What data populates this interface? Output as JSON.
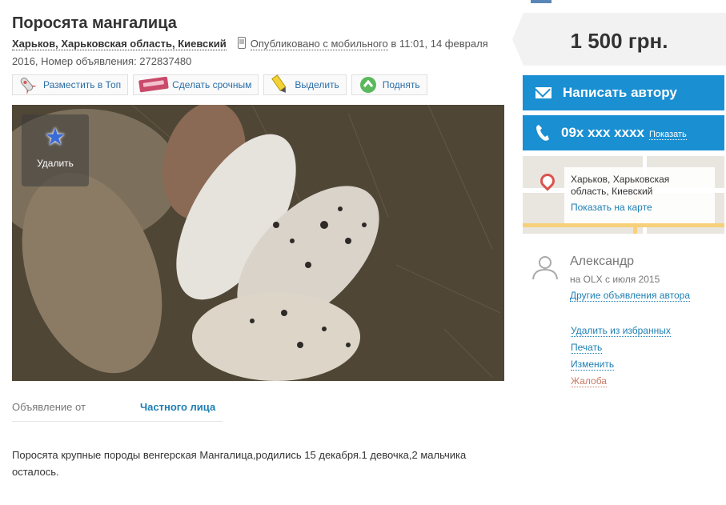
{
  "listing": {
    "title": "Поросята мангалица",
    "location": "Харьков, Харьковская область, Киевский",
    "published_text": "Опубликовано с мобильного",
    "published_time": " в 11:01, 14 февраля 2016, Номер объявления: 272837480"
  },
  "actions": [
    {
      "label": "Разместить в Топ",
      "icon": "rocket-icon"
    },
    {
      "label": "Сделать срочным",
      "icon": "urgent-sticker-icon"
    },
    {
      "label": "Выделить",
      "icon": "highlighter-icon"
    },
    {
      "label": "Поднять",
      "icon": "refresh-up-icon"
    }
  ],
  "photo": {
    "favorite_label": "Удалить"
  },
  "details": {
    "from_key": "Объявление от",
    "from_value": "Частного лица"
  },
  "description": "Поросята крупные породы венгерская Мангалица,родились 15 декабря.1 девочка,2 мальчика осталось.",
  "sidebar": {
    "price": "1 500 грн.",
    "write_author": "Написать автору",
    "phone": "09x xxx xxxx",
    "show_phone": "Показать",
    "map_address": "Харьков, Харьковская область, Киевский",
    "show_on_map": "Показать на карте",
    "user_name": "Александр",
    "user_since": "на OLX с июля 2015",
    "other_ads": "Другие объявления автора",
    "links": [
      "Удалить из избранных",
      "Печать",
      "Изменить",
      "Жалоба"
    ]
  },
  "colors": {
    "accent": "#1a8fd2",
    "link": "#1d7fb4",
    "complaint": "#c97a64"
  }
}
